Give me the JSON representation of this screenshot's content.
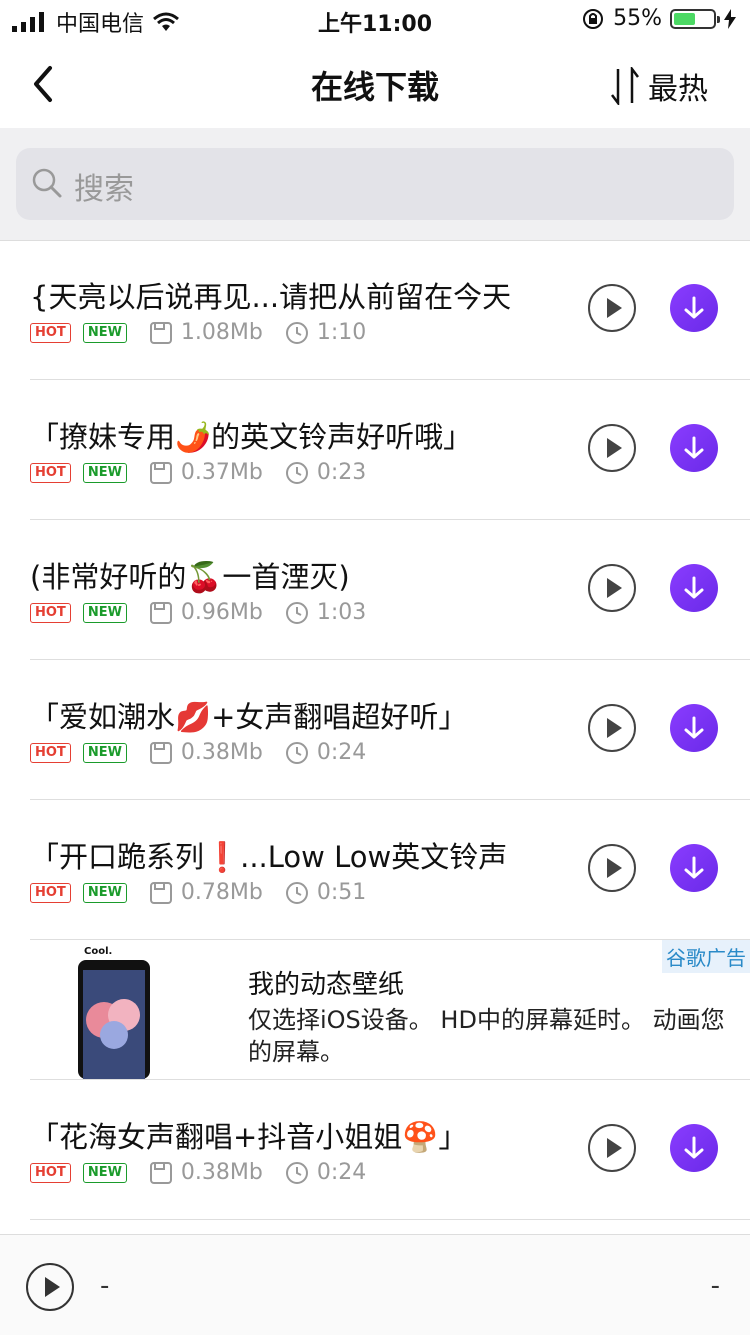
{
  "status": {
    "carrier": "中国电信",
    "time": "上午11:00",
    "battery": "55%",
    "battery_level": 0.55
  },
  "nav": {
    "title": "在线下载",
    "sort_label": "最热"
  },
  "search": {
    "placeholder": "搜索"
  },
  "tags": {
    "hot": "HOT",
    "new": "NEW"
  },
  "items": [
    {
      "title": "{天亮以后说再见...请把从前留在今天",
      "size": "1.08Mb",
      "duration": "1:10"
    },
    {
      "title": "「撩妹专用🌶️的英文铃声好听哦」",
      "size": "0.37Mb",
      "duration": "0:23"
    },
    {
      "title": "(非常好听的🍒一首湮灭)",
      "size": "0.96Mb",
      "duration": "1:03"
    },
    {
      "title": "「爱如潮水💋+女声翻唱超好听」",
      "size": "0.38Mb",
      "duration": "0:24"
    },
    {
      "title": "「开口跪系列❗...Low Low英文铃声",
      "size": "0.78Mb",
      "duration": "0:51"
    }
  ],
  "ad": {
    "badge": "谷歌广告",
    "phone_text": "Cool.",
    "title": "我的动态壁纸",
    "description": "仅选择iOS设备。 HD中的屏幕延时。 动画您的屏幕。"
  },
  "items_after_ad": [
    {
      "title": "「花海女声翻唱+抖音小姐姐🍄」",
      "size": "0.38Mb",
      "duration": "0:24"
    }
  ],
  "player": {
    "title": "-",
    "time": "-"
  }
}
